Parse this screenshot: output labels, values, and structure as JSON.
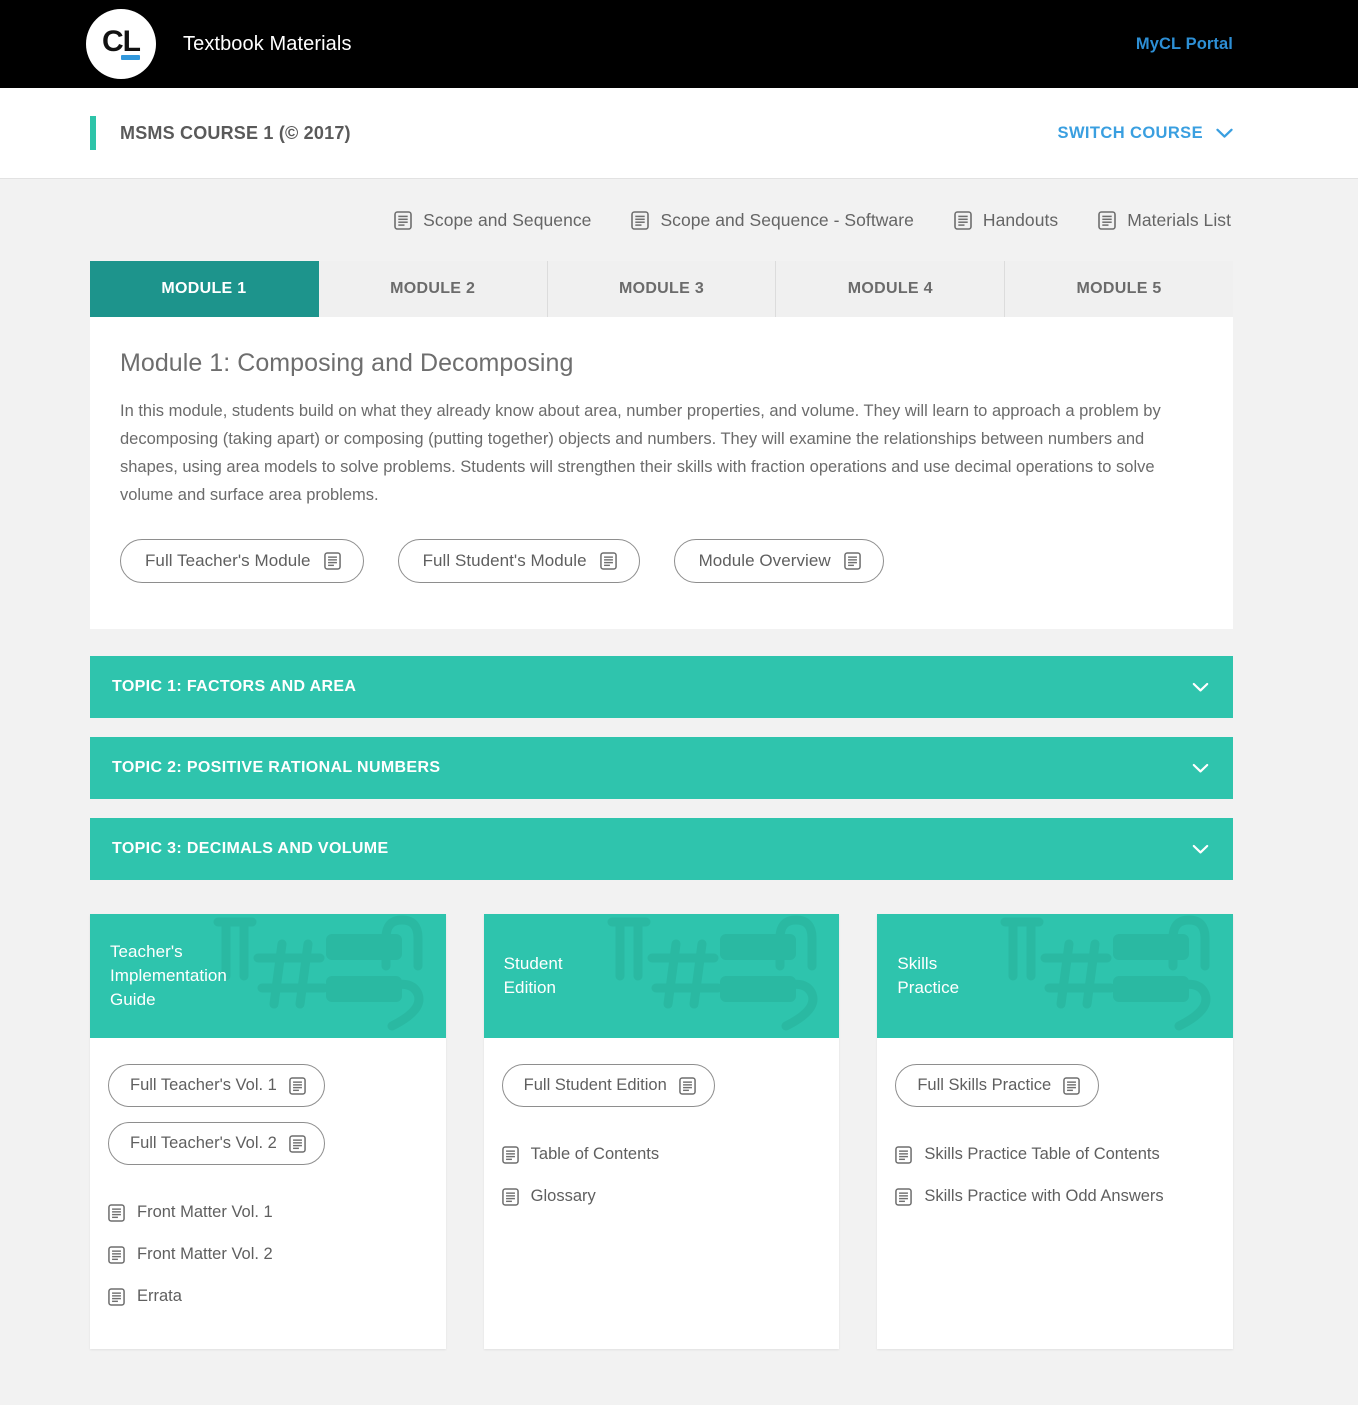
{
  "header": {
    "logo_text": "CL",
    "logo_name": "carnegie-learning-logo",
    "title": "Textbook Materials",
    "portal_link": "MyCL Portal",
    "portal_color": "#2d8fd5"
  },
  "course_bar": {
    "course_title": "MSMS COURSE 1 (© 2017)",
    "switch_course_label": "SWITCH COURSE",
    "switch_course_icon": "chevron-down-icon",
    "accent_color": "#2ec4a9",
    "link_color": "#3a9fe0"
  },
  "resource_links": [
    {
      "label": "Scope and Sequence",
      "icon": "document-icon"
    },
    {
      "label": "Scope and Sequence - Software",
      "icon": "document-icon"
    },
    {
      "label": "Handouts",
      "icon": "document-icon"
    },
    {
      "label": "Materials List",
      "icon": "document-icon"
    }
  ],
  "module_tabs": [
    {
      "label": "MODULE 1",
      "active": true
    },
    {
      "label": "MODULE 2",
      "active": false
    },
    {
      "label": "MODULE 3",
      "active": false
    },
    {
      "label": "MODULE 4",
      "active": false
    },
    {
      "label": "MODULE 5",
      "active": false
    }
  ],
  "module_panel": {
    "title": "Module 1: Composing and Decomposing",
    "description": "In this module, students build on what they already know about area, number properties, and volume. They will learn to approach a problem by decomposing (taking apart) or composing (putting together) objects and numbers. They will examine the relationships between numbers and shapes, using area models to solve problems. Students will strengthen their skills with fraction operations and use decimal operations to solve volume and surface area problems.",
    "buttons": [
      {
        "label": "Full Teacher's Module",
        "icon": "document-icon"
      },
      {
        "label": "Full Student's Module",
        "icon": "document-icon"
      },
      {
        "label": "Module Overview",
        "icon": "document-icon"
      }
    ]
  },
  "topics": [
    {
      "label": "TOPIC 1: FACTORS AND AREA",
      "icon": "chevron-down-icon"
    },
    {
      "label": "TOPIC 2: POSITIVE RATIONAL NUMBERS",
      "icon": "chevron-down-icon"
    },
    {
      "label": "TOPIC 3: DECIMALS AND VOLUME",
      "icon": "chevron-down-icon"
    }
  ],
  "topic_color": "#2fc4ad",
  "cards": [
    {
      "title": "Teacher's\nImplementation\nGuide",
      "buttons": [
        {
          "label": "Full Teacher's Vol. 1",
          "icon": "document-icon"
        },
        {
          "label": "Full Teacher's Vol. 2",
          "icon": "document-icon"
        }
      ],
      "links": [
        {
          "label": "Front Matter Vol. 1",
          "icon": "document-icon"
        },
        {
          "label": "Front Matter Vol. 2",
          "icon": "document-icon"
        },
        {
          "label": "Errata",
          "icon": "document-icon"
        }
      ]
    },
    {
      "title": "Student\nEdition",
      "buttons": [
        {
          "label": "Full Student Edition",
          "icon": "document-icon"
        }
      ],
      "links": [
        {
          "label": "Table of Contents",
          "icon": "document-icon"
        },
        {
          "label": "Glossary",
          "icon": "document-icon"
        }
      ]
    },
    {
      "title": "Skills\nPractice",
      "buttons": [
        {
          "label": "Full Skills Practice",
          "icon": "document-icon"
        }
      ],
      "links": [
        {
          "label": "Skills Practice Table of Contents",
          "icon": "document-icon"
        },
        {
          "label": "Skills Practice with Odd Answers",
          "icon": "document-icon"
        }
      ]
    }
  ]
}
